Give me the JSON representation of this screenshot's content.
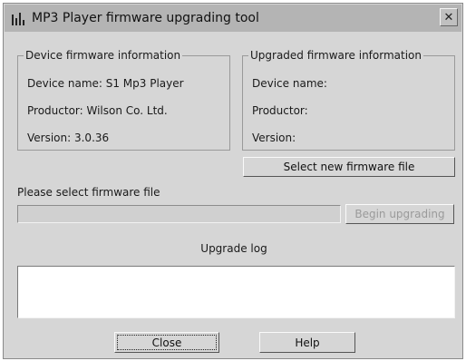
{
  "window": {
    "title": "MP3 Player firmware upgrading tool",
    "close_glyph": "✕"
  },
  "device_info": {
    "title": "Device firmware information",
    "device_name": "Device name: S1 Mp3 Player",
    "productor": "Productor: Wilson Co. Ltd.",
    "version": "Version: 3.0.36"
  },
  "upgraded_info": {
    "title": "Upgraded firmware information",
    "device_name": "Device name:",
    "productor": "Productor:",
    "version": "Version:"
  },
  "buttons": {
    "select_firmware": "Select new firmware file",
    "begin_upgrading": "Begin upgrading",
    "close": "Close",
    "help": "Help"
  },
  "prompt": "Please select firmware file",
  "log": {
    "label": "Upgrade log"
  },
  "progress": {
    "value": 0
  }
}
